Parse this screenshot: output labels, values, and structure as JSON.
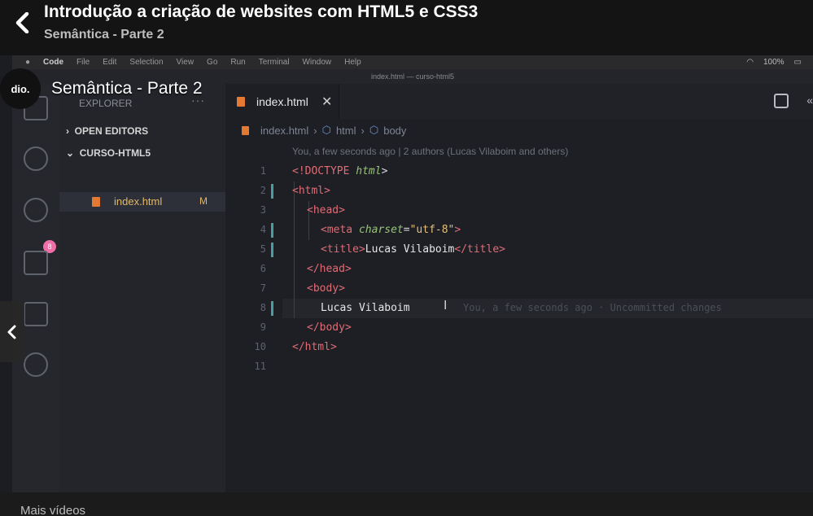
{
  "header": {
    "course_title": "Introdução a criação de websites com HTML5 e CSS3",
    "lesson_subtitle": "Semântica - Parte 2",
    "back_icon": "chevron-left-icon"
  },
  "video": {
    "mac_menubar": {
      "apple_icon": "apple-icon",
      "app_name": "Code",
      "items": [
        "File",
        "Edit",
        "Selection",
        "View",
        "Go",
        "Run",
        "Terminal",
        "Window",
        "Help"
      ],
      "battery": "100%"
    },
    "window_title": "index.html — curso-html5",
    "activity_bar": {
      "badge": "8",
      "icons": [
        "files-icon",
        "search-icon",
        "source-control-icon",
        "run-debug-icon",
        "extensions-icon",
        "remote-icon"
      ]
    },
    "sidebar": {
      "title": "EXPLORER",
      "more": "···",
      "sections": [
        "OPEN EDITORS",
        "CURSO-HTML5"
      ],
      "file": {
        "name": "index.html",
        "status": "M"
      }
    },
    "editor": {
      "tab": {
        "label": "index.html",
        "close": "✕"
      },
      "breadcrumb": [
        "index.html",
        "html",
        "body"
      ],
      "blame_header": "You, a few seconds ago | 2 authors (Lucas Vilaboim and others)",
      "line_numbers": [
        "1",
        "2",
        "3",
        "4",
        "5",
        "6",
        "7",
        "8",
        "9",
        "10",
        "11"
      ],
      "lines": {
        "l1_a": "<!DOCTYPE ",
        "l1_b": "html",
        "l1_c": ">",
        "l2": "<html>",
        "l3": "<head>",
        "l4_a": "<meta ",
        "l4_b": "charset",
        "l4_c": "=",
        "l4_d": "\"utf-8\"",
        "l4_e": ">",
        "l5_a": "<title>",
        "l5_b": "Lucas Vilaboim",
        "l5_c": "</title>",
        "l6": "</head>",
        "l7": "<body>",
        "l8": "Lucas Vilaboim",
        "l9": "</body>",
        "l10": "</html>"
      },
      "inline_blame": "You, a few seconds ago · Uncommitted changes"
    },
    "overlay": {
      "channel_logo": "dio.",
      "title": "Semântica - Parte 2"
    }
  },
  "footer": {
    "more_videos": "Mais vídeos"
  },
  "colors": {
    "tag": "#e06c75",
    "attr": "#98c379",
    "string": "#e5c07b",
    "file_modified": "#e2b868",
    "html_icon": "#e37933",
    "badge": "#ef6ea7"
  }
}
